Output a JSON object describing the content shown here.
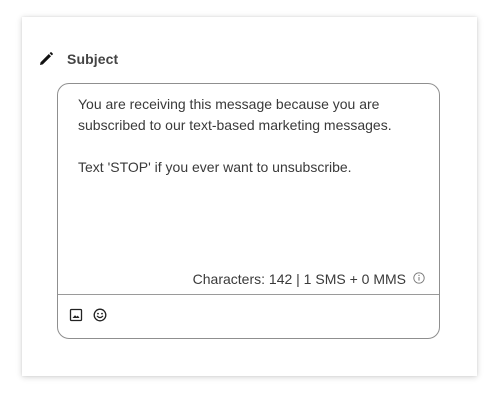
{
  "subject": {
    "label": "Subject",
    "icon": "pencil-icon"
  },
  "composer": {
    "message_line1": "You are receiving this message because you are",
    "message_line2": "subscribed to our text-based marketing messages.",
    "message_line3": "",
    "message_line4": "Text 'STOP' if you ever want to unsubscribe.",
    "counter_text": "Characters: 142 | 1 SMS + 0 MMS",
    "info_icon": "info-icon"
  },
  "toolbar": {
    "image_icon": "image-icon",
    "emoji_icon": "emoji-icon"
  }
}
